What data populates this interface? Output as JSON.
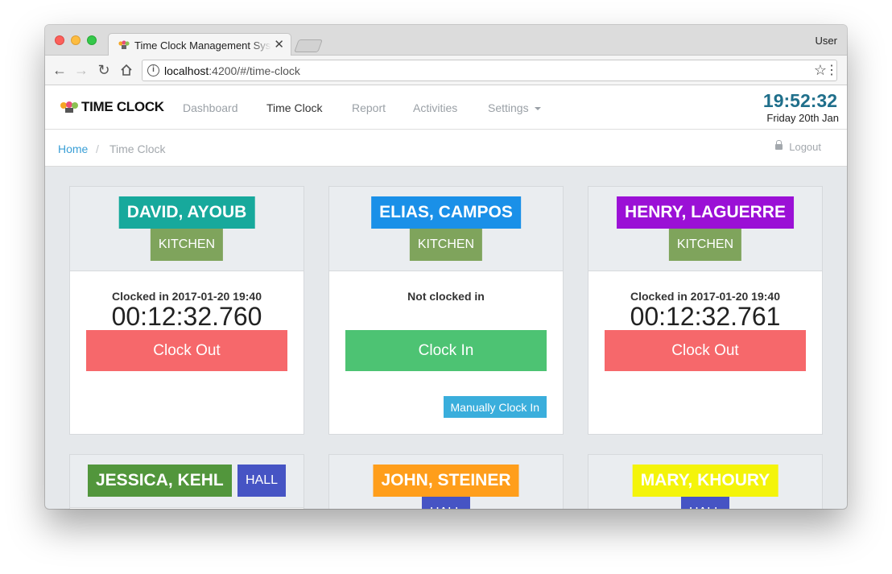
{
  "browser": {
    "tab_title": "Time Clock Management System",
    "tab_close": "✕",
    "profile": "User",
    "url_host": "localhost",
    "url_rest": ":4200/#/time-clock",
    "info_glyph": "i",
    "icons": [
      "back-arrow-icon",
      "forward-arrow-icon",
      "reload-icon",
      "home-icon",
      "info-icon",
      "star-icon",
      "menu-icon"
    ]
  },
  "navbar": {
    "brand": "TIME CLOCK",
    "links": [
      "Dashboard",
      "Time Clock",
      "Report",
      "Activities",
      "Settings"
    ],
    "active": "Time Clock",
    "clock_time": "19:52:32",
    "clock_date": "Friday 20th Jan"
  },
  "breadcrumb": {
    "home": "Home",
    "separator": "/",
    "current": "Time Clock",
    "logout": "Logout"
  },
  "colors": {
    "kitchen": "#7fa45c",
    "hall": "#4654c4",
    "clock_out": "#f6686b",
    "clock_in": "#4dc373",
    "manual": "#3aaedc",
    "time": "#1f6f8b"
  },
  "employees": [
    {
      "name": "DAVID, AYOUB",
      "name_color": "#17a99c",
      "dept": "KITCHEN",
      "status": "Clocked in 2017-01-20 19:40",
      "timer": "00:12:32.760",
      "action": "Clock Out"
    },
    {
      "name": "ELIAS, CAMPOS",
      "name_color": "#1a90e8",
      "dept": "KITCHEN",
      "status": "Not clocked in",
      "action": "Clock In",
      "manual": "Manually Clock In"
    },
    {
      "name": "HENRY, LAGUERRE",
      "name_color": "#9b10d6",
      "dept": "KITCHEN",
      "status": "Clocked in 2017-01-20 19:40",
      "timer": "00:12:32.761",
      "action": "Clock Out"
    },
    {
      "name": "JESSICA, KEHL",
      "name_color": "#52963c",
      "dept": "HALL"
    },
    {
      "name": "JOHN, STEINER",
      "name_color": "#ff9e1b",
      "dept": "HALL"
    },
    {
      "name": "MARY, KHOURY",
      "name_color": "#f4f40a",
      "dept": "HALL"
    }
  ]
}
